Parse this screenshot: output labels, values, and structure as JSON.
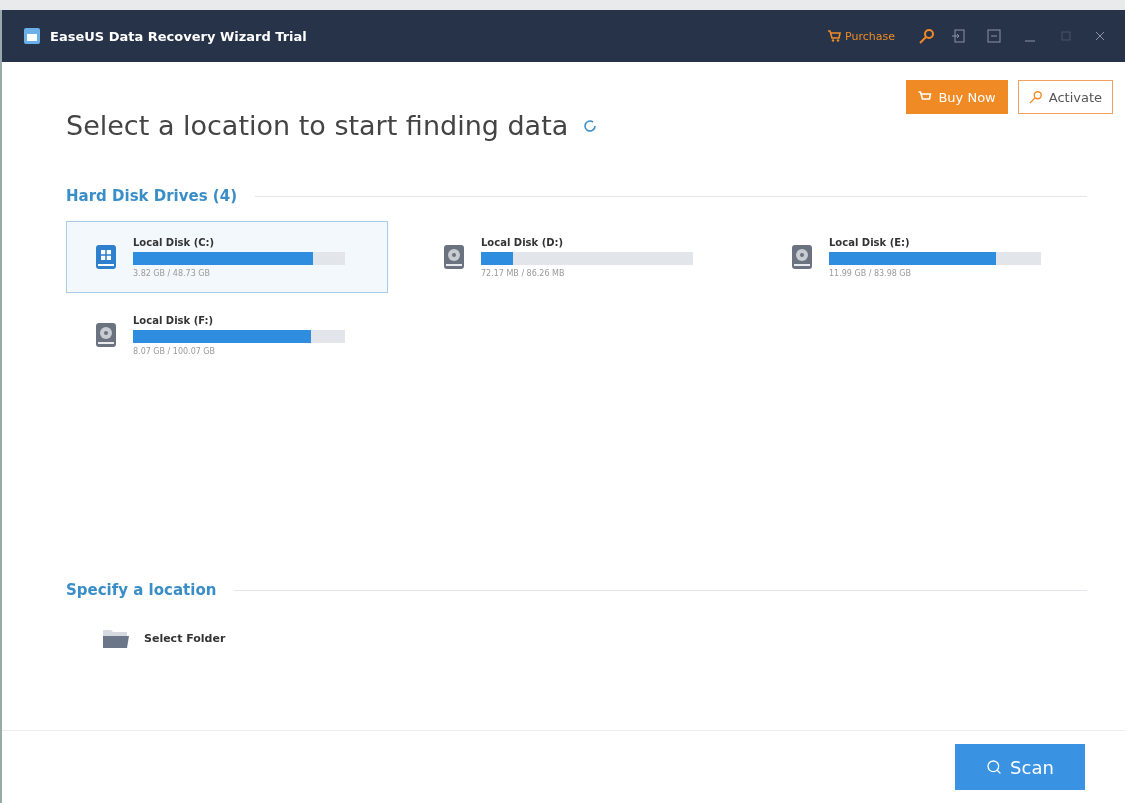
{
  "window": {
    "title": "EaseUS Data Recovery Wizard Trial"
  },
  "titlebar": {
    "purchase": "Purchase"
  },
  "header": {
    "buy_now": "Buy Now",
    "activate": "Activate"
  },
  "heading": "Select a location to start finding data",
  "drives_section": {
    "title": "Hard Disk Drives (4)",
    "drives": [
      {
        "name": "Local Disk (C:)",
        "usage": "3.82 GB / 48.73 GB",
        "level": 0.85,
        "kind": "system",
        "selected": true
      },
      {
        "name": "Local Disk (D:)",
        "usage": "72.17 MB / 86.26 MB",
        "level": 0.15,
        "kind": "disk",
        "selected": false
      },
      {
        "name": "Local Disk (E:)",
        "usage": "11.99 GB / 83.98 GB",
        "level": 0.79,
        "kind": "disk",
        "selected": false
      },
      {
        "name": "Local Disk (F:)",
        "usage": "8.07 GB / 100.07 GB",
        "level": 0.84,
        "kind": "disk",
        "selected": false
      }
    ]
  },
  "location_section": {
    "title": "Specify a location",
    "select_folder": "Select Folder"
  },
  "scan_button": "Scan"
}
